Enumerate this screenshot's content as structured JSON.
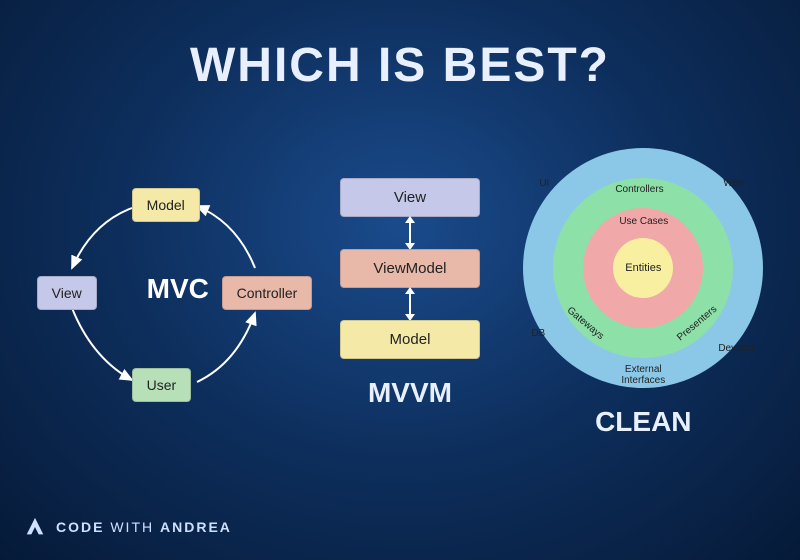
{
  "title": "WHICH IS BEST?",
  "mvc": {
    "label": "MVC",
    "nodes": {
      "model": "Model",
      "view": "View",
      "controller": "Controller",
      "user": "User"
    }
  },
  "mvvm": {
    "label": "MVVM",
    "view": "View",
    "viewmodel": "ViewModel",
    "model": "Model"
  },
  "clean": {
    "label": "CLEAN",
    "rings": {
      "entities": "Entities",
      "usecases": "Use Cases",
      "controllers": "Controllers",
      "gateways": "Gateways",
      "presenters": "Presenters",
      "ui": "UI",
      "web": "Web",
      "db": "DB",
      "devices": "Devices",
      "external": "External Interfaces"
    }
  },
  "brand": {
    "code": "CODE",
    "with": "WITH",
    "name": "ANDREA"
  }
}
